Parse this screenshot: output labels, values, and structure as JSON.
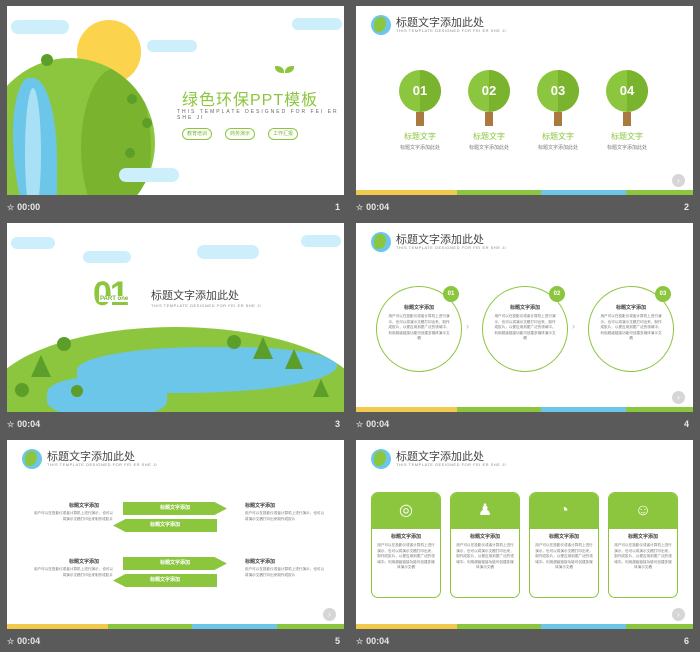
{
  "slides": [
    {
      "time": "00:00",
      "number": "1",
      "title": "绿色环保PPT模板",
      "subtitle": "THIS TEMPLATE DESIGNED FOR FEI ER SHE JI",
      "tags": [
        "教育培训",
        "商务演示",
        "工作汇报"
      ]
    },
    {
      "time": "00:04",
      "number": "2",
      "header_title": "标题文字添加此处",
      "header_sub": "THIS TEMPLATE DESIGNED FOR FEI ER SHE JI",
      "items": [
        {
          "num": "01",
          "title": "标题文字",
          "desc": "标题文字添加此处"
        },
        {
          "num": "02",
          "title": "标题文字",
          "desc": "标题文字添加此处"
        },
        {
          "num": "03",
          "title": "标题文字",
          "desc": "标题文字添加此处"
        },
        {
          "num": "04",
          "title": "标题文字",
          "desc": "标题文字添加此处"
        }
      ]
    },
    {
      "time": "00:04",
      "number": "3",
      "big": "01",
      "part": "PART one",
      "title": "标题文字添加此处",
      "subtitle": "THIS TEMPLATE DESIGNED FOR FEI ER SHE JI"
    },
    {
      "time": "00:04",
      "number": "4",
      "header_title": "标题文字添加此处",
      "header_sub": "THIS TEMPLATE DESIGNED FOR FEI ER SHE JI",
      "items": [
        {
          "num": "01",
          "title": "标题文字添加",
          "desc": "用户可以在投影仪或者计算机上进行演示，也可以将演示文稿打印出来，制作成胶片，以便应用到更广泛的领域中。利用超级链接功能可创建多媒体演示文稿"
        },
        {
          "num": "02",
          "title": "标题文字添加",
          "desc": "用户可以在投影仪或者计算机上进行演示，也可以将演示文稿打印出来，制作成胶片，以便应用到更广泛的领域中。利用超级链接功能可创建多媒体演示文稿"
        },
        {
          "num": "03",
          "title": "标题文字添加",
          "desc": "用户可以在投影仪或者计算机上进行演示，也可以将演示文稿打印出来，制作成胶片，以便应用到更广泛的领域中。利用超级链接功能可创建多媒体演示文稿"
        }
      ]
    },
    {
      "time": "00:04",
      "number": "5",
      "header_title": "标题文字添加此处",
      "header_sub": "THIS TEMPLATE DESIGNED FOR FEI ER SHE JI",
      "arrow_label": "标题文字添加",
      "item_title": "标题文字添加",
      "item_desc": "用户可以在投影仪或者计算机上进行演示，也可以将演示文稿打印出来制作成胶片"
    },
    {
      "time": "00:04",
      "number": "6",
      "header_title": "标题文字添加此处",
      "header_sub": "THIS TEMPLATE DESIGNED FOR FEI ER SHE JI",
      "cards": [
        {
          "icon": "target-icon",
          "glyph": "◎",
          "title": "标题文字添加",
          "desc": "用户可以在投影仪或者计算机上进行演示，也可以将演示文稿打印出来，制作成胶片，以便应用到更广泛的领域中。利用超级链接功能可创建多媒体演示文稿"
        },
        {
          "icon": "team-icon",
          "glyph": "♟",
          "title": "标题文字添加",
          "desc": "用户可以在投影仪或者计算机上进行演示，也可以将演示文稿打印出来，制作成胶片，以便应用到更广泛的领域中。利用超级链接功能可创建多媒体演示文稿"
        },
        {
          "icon": "pie-chart-icon",
          "glyph": "◔",
          "title": "标题文字添加",
          "desc": "用户可以在投影仪或者计算机上进行演示，也可以将演示文稿打印出来，制作成胶片，以便应用到更广泛的领域中。利用超级链接功能可创建多媒体演示文稿"
        },
        {
          "icon": "presenter-icon",
          "glyph": "☺",
          "title": "标题文字添加",
          "desc": "用户可以在投影仪或者计算机上进行演示，也可以将演示文稿打印出来，制作成胶片，以便应用到更广泛的领域中。利用超级链接功能可创建多媒体演示文稿"
        }
      ]
    }
  ],
  "colors": {
    "accent": "#8cc63f",
    "accent_dark": "#7ab32e",
    "water": "#6cc6e9",
    "sun": "#fcd34d",
    "cloud": "#cdeefb",
    "trunk": "#a9793f",
    "bar": [
      "#f0c94d",
      "#8cc63f",
      "#6cc6e9",
      "#8cc63f"
    ]
  }
}
